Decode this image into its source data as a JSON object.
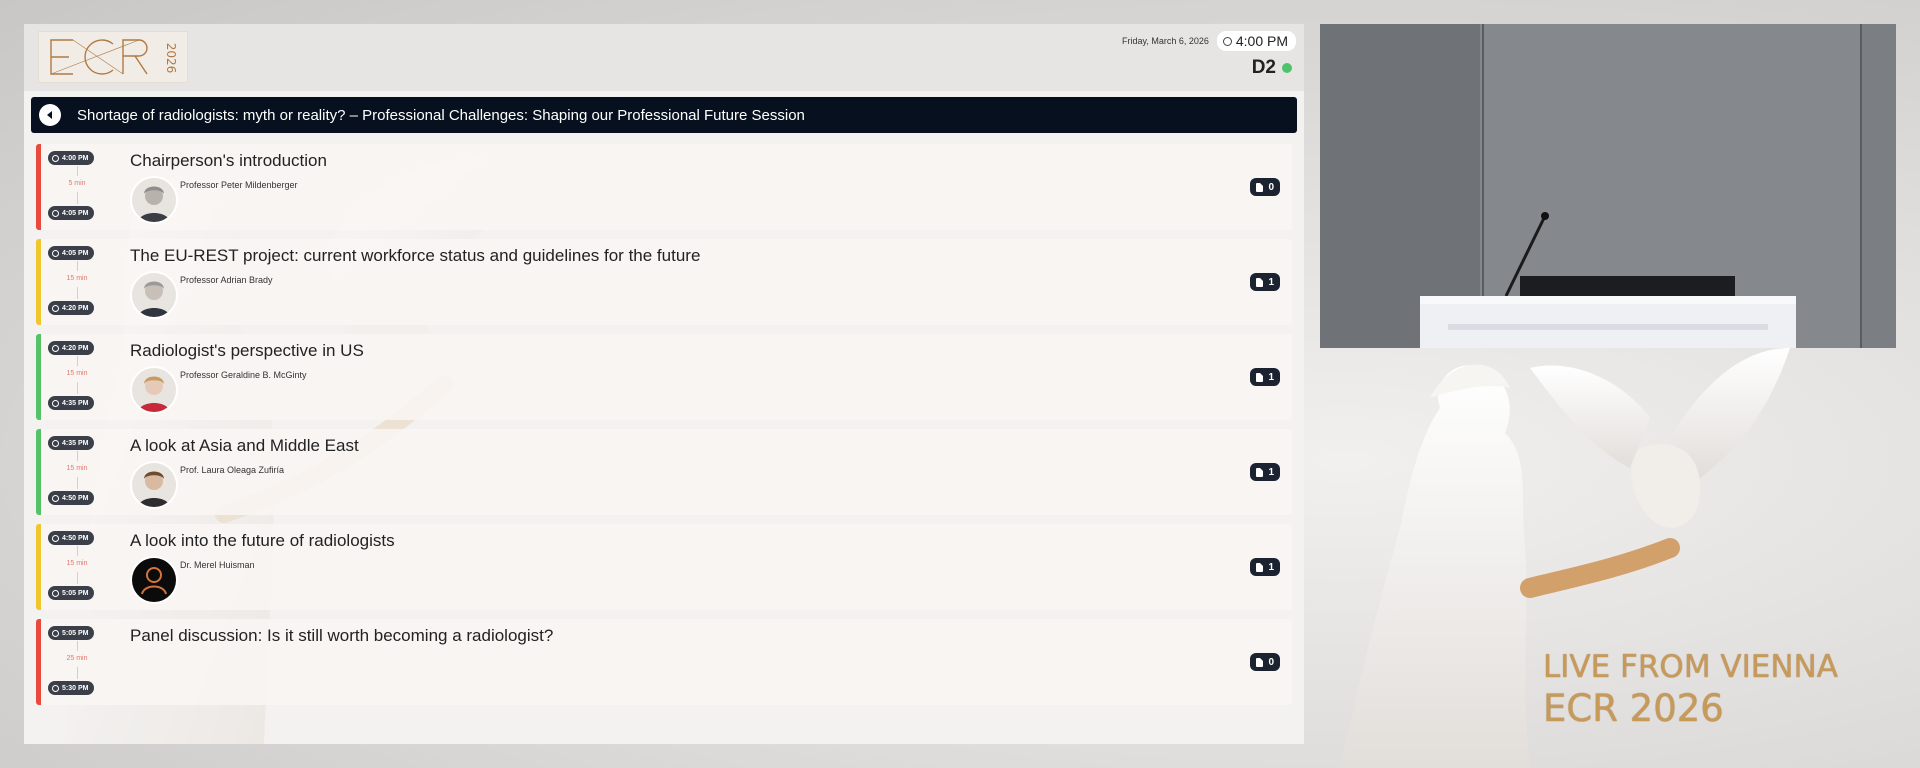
{
  "header": {
    "logo_text": "ECR 2026",
    "date": "Friday, March 6, 2026",
    "time": "4:00 PM",
    "room": "D2",
    "live_status_color": "#4fc36a"
  },
  "session": {
    "title": "Shortage of radiologists: myth or reality? – Professional Challenges: Shaping our Professional Future Session"
  },
  "talks": [
    {
      "start": "4:00 PM",
      "end": "4:05 PM",
      "duration": "5 min",
      "title": "Chairperson's introduction",
      "speaker": "Professor Peter Mildenberger",
      "docs": "0",
      "color": "#e94a3b",
      "avatar": "photo"
    },
    {
      "start": "4:05 PM",
      "end": "4:20 PM",
      "duration": "15 min",
      "title": "The EU-REST project: current workforce status and guidelines for the future",
      "speaker": "Professor Adrian Brady",
      "docs": "1",
      "color": "#f1c62c",
      "avatar": "photo"
    },
    {
      "start": "4:20 PM",
      "end": "4:35 PM",
      "duration": "15 min",
      "title": "Radiologist's perspective in US",
      "speaker": "Professor Geraldine B. McGinty",
      "docs": "1",
      "color": "#56c268",
      "avatar": "photo"
    },
    {
      "start": "4:35 PM",
      "end": "4:50 PM",
      "duration": "15 min",
      "title": "A look at Asia and Middle East",
      "speaker": "Prof. Laura Oleaga Zufiría",
      "docs": "1",
      "color": "#56c268",
      "avatar": "photo"
    },
    {
      "start": "4:50 PM",
      "end": "5:05 PM",
      "duration": "15 min",
      "title": "A look into the future of radiologists",
      "speaker": "Dr. Merel Huisman",
      "docs": "1",
      "color": "#f1c62c",
      "avatar": "placeholder"
    },
    {
      "start": "5:05 PM",
      "end": "5:30 PM",
      "duration": "25 min",
      "title": "Panel discussion: Is it still worth becoming a radiologist?",
      "speaker": "",
      "docs": "0",
      "color": "#e94a3b",
      "avatar": "none"
    }
  ],
  "overlay": {
    "line1": "LIVE FROM VIENNA",
    "line2": "ECR 2026",
    "accent_color": "#c79a5a"
  }
}
